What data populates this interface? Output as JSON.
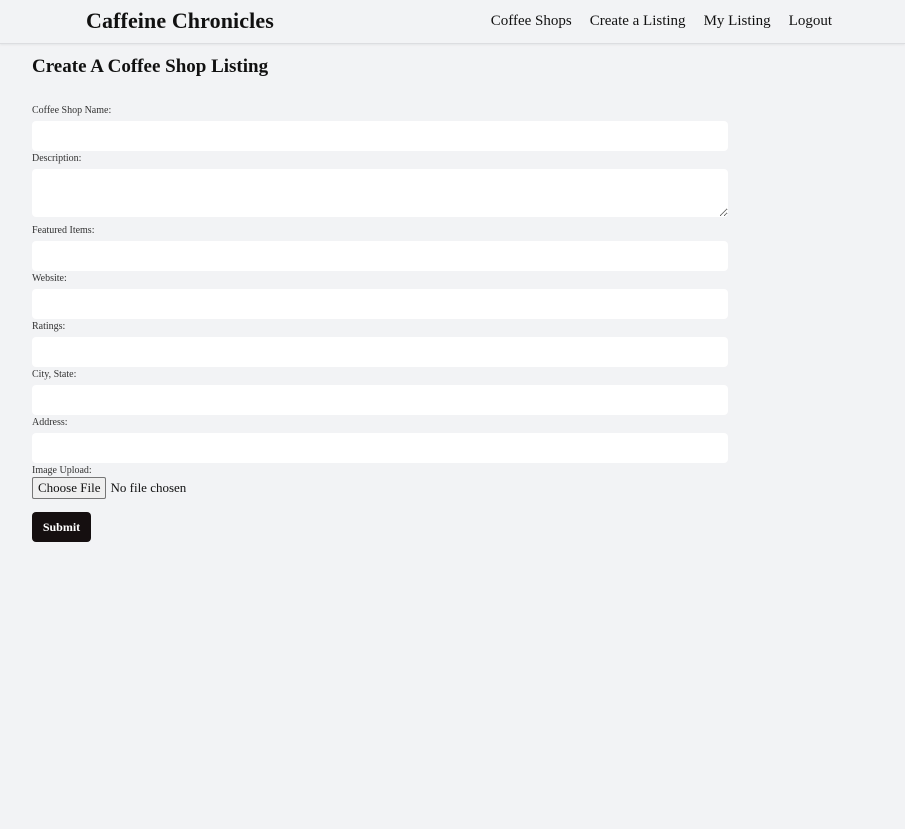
{
  "nav": {
    "brand": "Caffeine Chronicles",
    "links": [
      "Coffee Shops",
      "Create a Listing",
      "My Listing",
      "Logout"
    ]
  },
  "page": {
    "title": "Create A Coffee Shop Listing"
  },
  "form": {
    "name_label": "Coffee Shop Name:",
    "name_value": "",
    "description_label": "Description:",
    "description_value": "",
    "featured_label": "Featured Items:",
    "featured_value": "",
    "website_label": "Website:",
    "website_value": "",
    "ratings_label": "Ratings:",
    "ratings_value": "",
    "city_label": "City, State:",
    "city_value": "",
    "address_label": "Address:",
    "address_value": "",
    "image_label": "Image Upload:",
    "choose_file_label": "Choose File",
    "file_status": "No file chosen",
    "submit_label": "Submit"
  }
}
